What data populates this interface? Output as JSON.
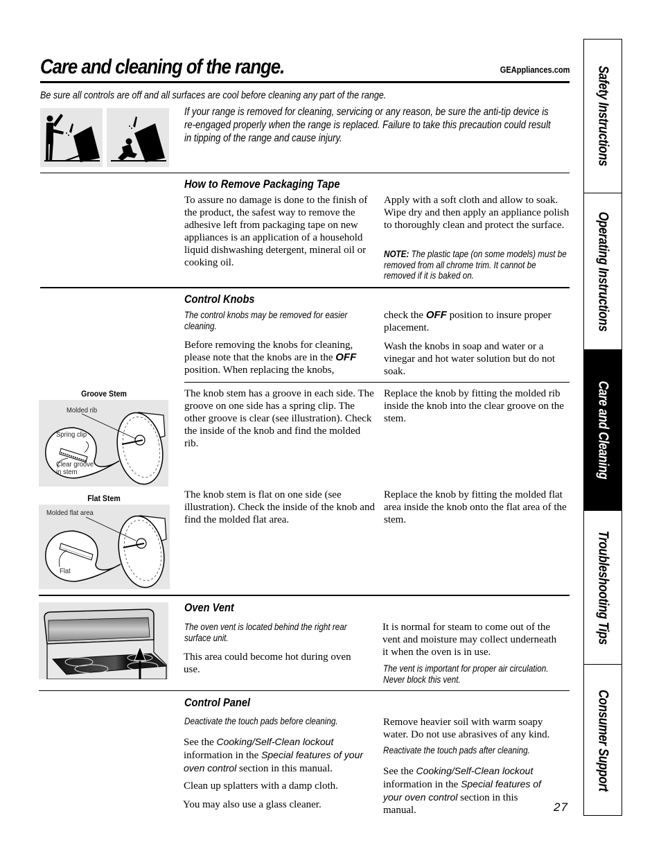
{
  "header": {
    "title": "Care and cleaning of the range.",
    "website": "GEAppliances.com"
  },
  "warning": "Be sure all controls are off and all surfaces are cool before cleaning any part of the range.",
  "anti_tip": {
    "text": "If your range is removed for cleaning, servicing or any reason, be sure the anti-tip device is re-engaged properly when the range is replaced. Failure to take this precaution could result in tipping of the range and cause injury.",
    "icons": [
      "adult-tipping-range-icon",
      "child-tipping-range-icon"
    ]
  },
  "packaging_tape": {
    "heading": "How to Remove Packaging Tape",
    "left": "To assure no damage is done to the finish of the product, the safest way to remove the adhesive left from packaging tape on new appliances is an application of a household liquid dishwashing detergent, mineral oil or cooking oil.",
    "right": "Apply with a soft cloth and allow to soak. Wipe dry and then apply an appliance polish to thoroughly clean and protect the surface.",
    "note_label": "NOTE:",
    "note": "The plastic tape (on some models) must be removed from all chrome trim. It cannot be removed if it is baked on."
  },
  "control_knobs": {
    "heading": "Control Knobs",
    "intro": "The control knobs may be removed for easier cleaning.",
    "left_p1": "Before removing the knobs for cleaning, please note that the knobs are in the",
    "off": "OFF",
    "left_p1_end": "position. When replacing the knobs,",
    "right_p1_start": "check the",
    "right_p1_end": "position to insure proper placement.",
    "right_p2": "Wash the knobs in soap and water or a vinegar and hot water solution but do not soak.",
    "groove": {
      "label": "Groove Stem",
      "callouts": [
        "Molded rib",
        "Spring clip",
        "Clear groove",
        "in stem"
      ],
      "left": "The knob stem has a groove in each side. The groove on one side has a spring clip. The other groove is clear (see illustration). Check the inside of the knob and find the molded rib.",
      "right": "Replace the knob by fitting the molded rib inside the knob into the clear groove on the stem."
    },
    "flat": {
      "label": "Flat Stem",
      "callouts": [
        "Molded flat area",
        "Flat"
      ],
      "left": "The knob stem is flat on one side (see illustration). Check the inside of the knob and find the molded flat area.",
      "right": "Replace the knob by fitting the molded flat area inside the knob onto the flat area of the stem."
    }
  },
  "oven_vent": {
    "heading": "Oven Vent",
    "intro": "The oven vent is located behind the right rear surface unit.",
    "left": "This area could become hot during oven use.",
    "right": "It is normal for steam to come out of the vent and moisture may collect underneath it when the oven is in use.",
    "right_note": "The vent is important for proper air circulation. Never block this vent."
  },
  "control_panel": {
    "heading": "Control Panel",
    "intro": "Deactivate the touch pads before cleaning.",
    "left_see": "See the",
    "lockout": "Cooking/Self-Clean lockout",
    "info_in": "information in the",
    "special_features": "Special features of",
    "oven_control": "your oven control",
    "section_end": "section in this manual.",
    "special_features_r": "Special features",
    "oven_control_r": "of your oven control",
    "section_end_r": "section in this manual.",
    "left_p2": "Clean up splatters with a damp cloth.",
    "left_p3": "You may also use a glass cleaner.",
    "right_p1": "Remove heavier soil with warm soapy water. Do not use abrasives of any kind.",
    "right_note": "Reactivate the touch pads after cleaning."
  },
  "side_tabs": [
    {
      "label": "Safety Instructions",
      "active": false
    },
    {
      "label": "Operating Instructions",
      "active": false
    },
    {
      "label": "Care and Cleaning",
      "active": true
    },
    {
      "label": "Troubleshooting Tips",
      "active": false
    },
    {
      "label": "Consumer Support",
      "active": false
    }
  ],
  "page_number": "27"
}
